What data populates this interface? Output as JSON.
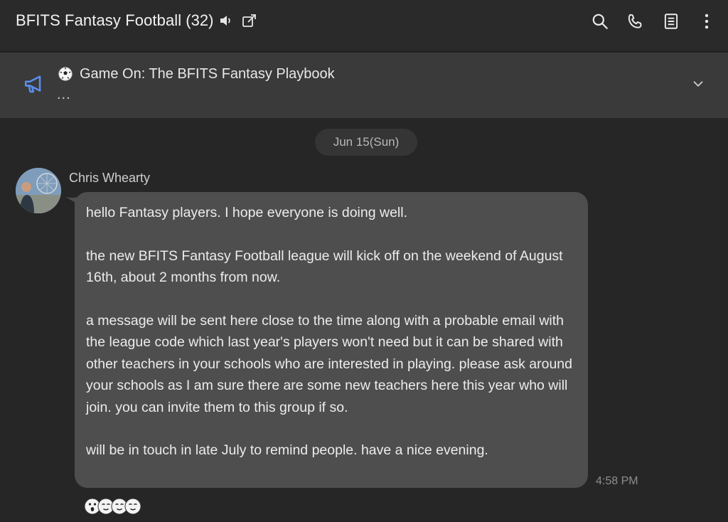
{
  "header": {
    "title": "BFITS Fantasy Football",
    "member_count": "(32)",
    "icons": [
      "speaker-icon",
      "popout-icon",
      "search-icon",
      "phone-icon",
      "notes-icon",
      "more-vertical-icon"
    ]
  },
  "announcement": {
    "title": "Game On: The BFITS Fantasy Playbook",
    "preview": "...",
    "icons": [
      "megaphone-icon",
      "soccer-ball-icon",
      "chevron-down-icon"
    ]
  },
  "date_divider": "Jun 15(Sun)",
  "message": {
    "sender": "Chris Whearty",
    "time": "4:58 PM",
    "paragraphs": [
      "hello Fantasy players. I hope everyone is doing well.",
      "the new BFITS Fantasy Football league will kick off on the weekend of August 16th, about 2 months from now.",
      "a message will be sent here close to the time along with a probable email with the league code which last year's players won't need but it can be shared with other teachers in your schools who are interested in playing. please ask around your schools as I am sure there are some new teachers here this year who will join. you can invite them to this group if so.",
      "will be in touch in late July to remind people. have a nice evening."
    ]
  },
  "reactions": {
    "icons": [
      "surprised-reaction-icon",
      "relieved-reaction-icon",
      "relieved-reaction-icon",
      "relieved-reaction-icon"
    ]
  },
  "colors": {
    "header_bg": "#2a2a2a",
    "announce_bg": "#3a3a3a",
    "chat_bg": "#262626",
    "bubble_bg": "#4e4e4e",
    "accent_blue": "#5b8def"
  }
}
